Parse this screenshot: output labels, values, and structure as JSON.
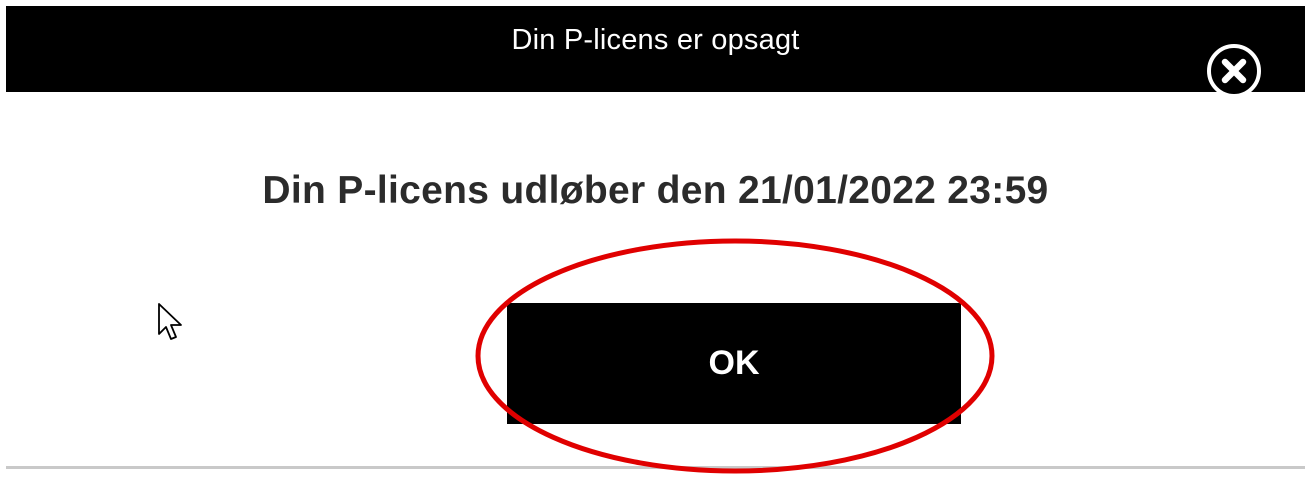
{
  "dialog": {
    "title": "Din P-licens er opsagt",
    "message": "Din P-licens udløber den 21/01/2022 23:59",
    "ok_label": "OK",
    "close_icon": "close-circle-icon"
  },
  "colors": {
    "titlebar_bg": "#000000",
    "button_bg": "#000000",
    "button_text": "#ffffff",
    "message_text": "#2b2b2b",
    "annotation_circle": "#e00000"
  }
}
